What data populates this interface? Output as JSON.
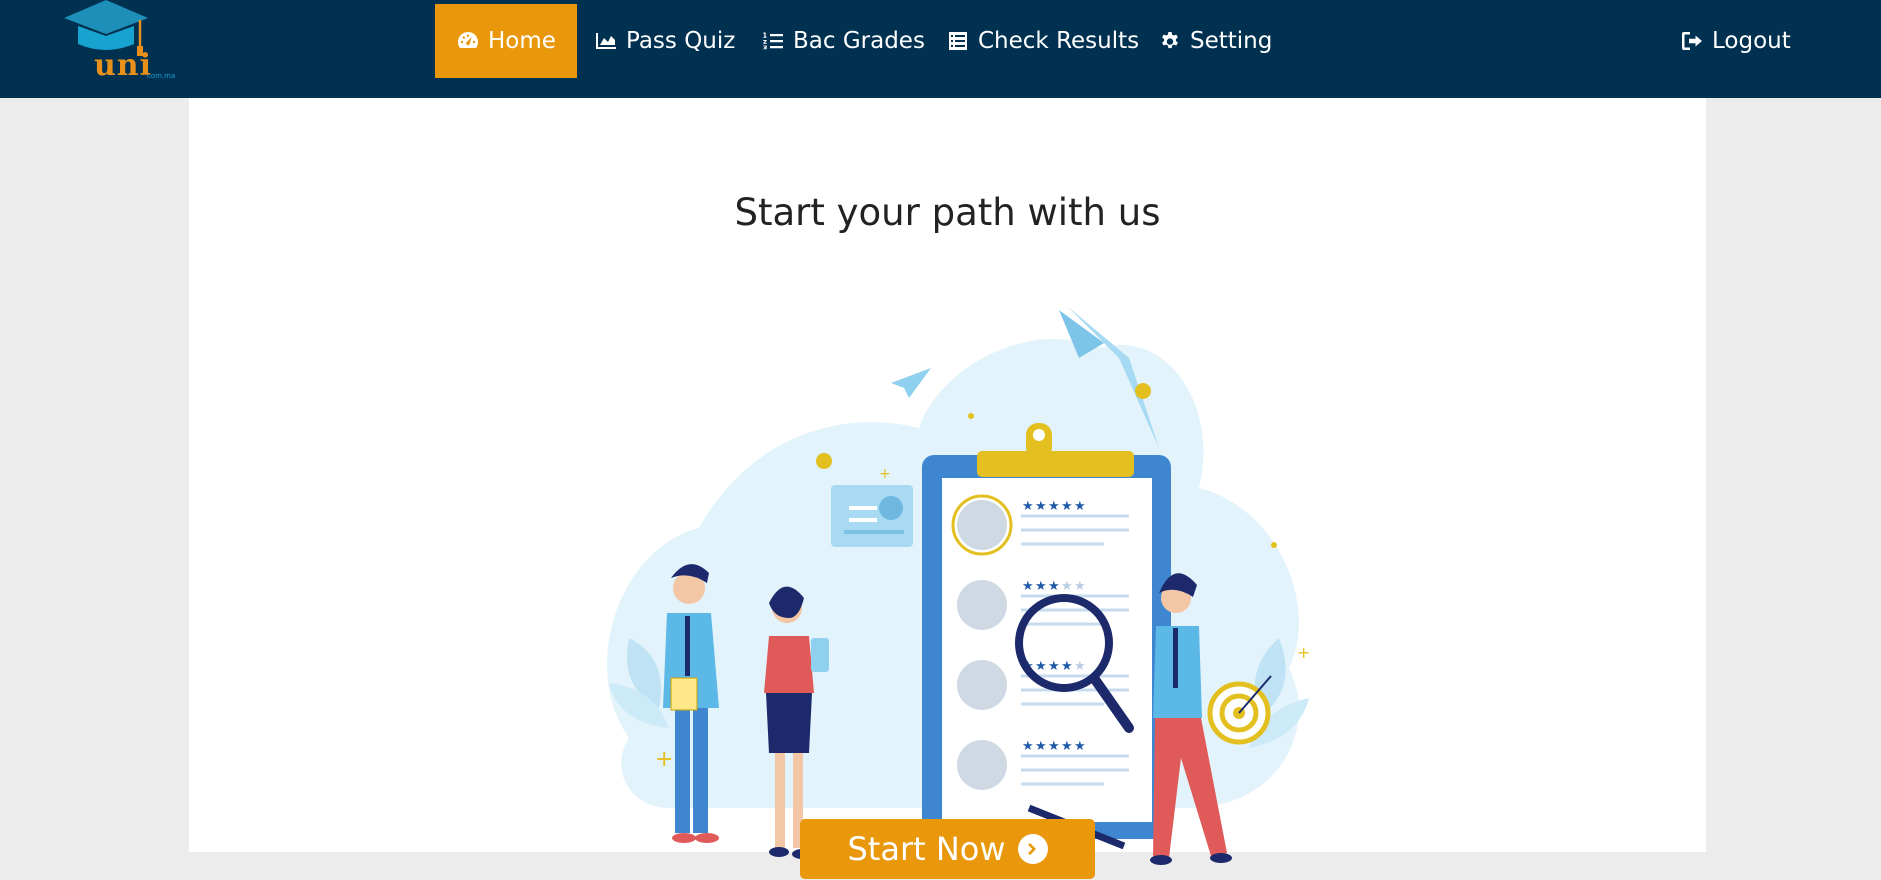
{
  "brand": {
    "logo_text": "uni",
    "logo_sub": "com.ma"
  },
  "nav": {
    "items": [
      {
        "label": "Home",
        "icon": "tachometer-icon",
        "active": true
      },
      {
        "label": "Pass Quiz",
        "icon": "area-chart-icon"
      },
      {
        "label": "Bac Grades",
        "icon": "numbered-list-icon"
      },
      {
        "label": "Check Results",
        "icon": "list-alt-icon"
      },
      {
        "label": "Setting",
        "icon": "gear-icon"
      }
    ],
    "logout_label": "Logout",
    "logout_icon": "sign-out-icon"
  },
  "main": {
    "headline": "Start your path with us",
    "cta_label": "Start Now",
    "cta_icon": "arrow-circle-right-icon",
    "illustration": "team-reviewing-clipboard-checklist",
    "checklist_ratings": [
      5,
      3,
      4,
      5
    ]
  },
  "colors": {
    "navbar": "#003151",
    "accent": "#e8980a",
    "page_bg": "#ececec",
    "content_bg": "#ffffff"
  }
}
